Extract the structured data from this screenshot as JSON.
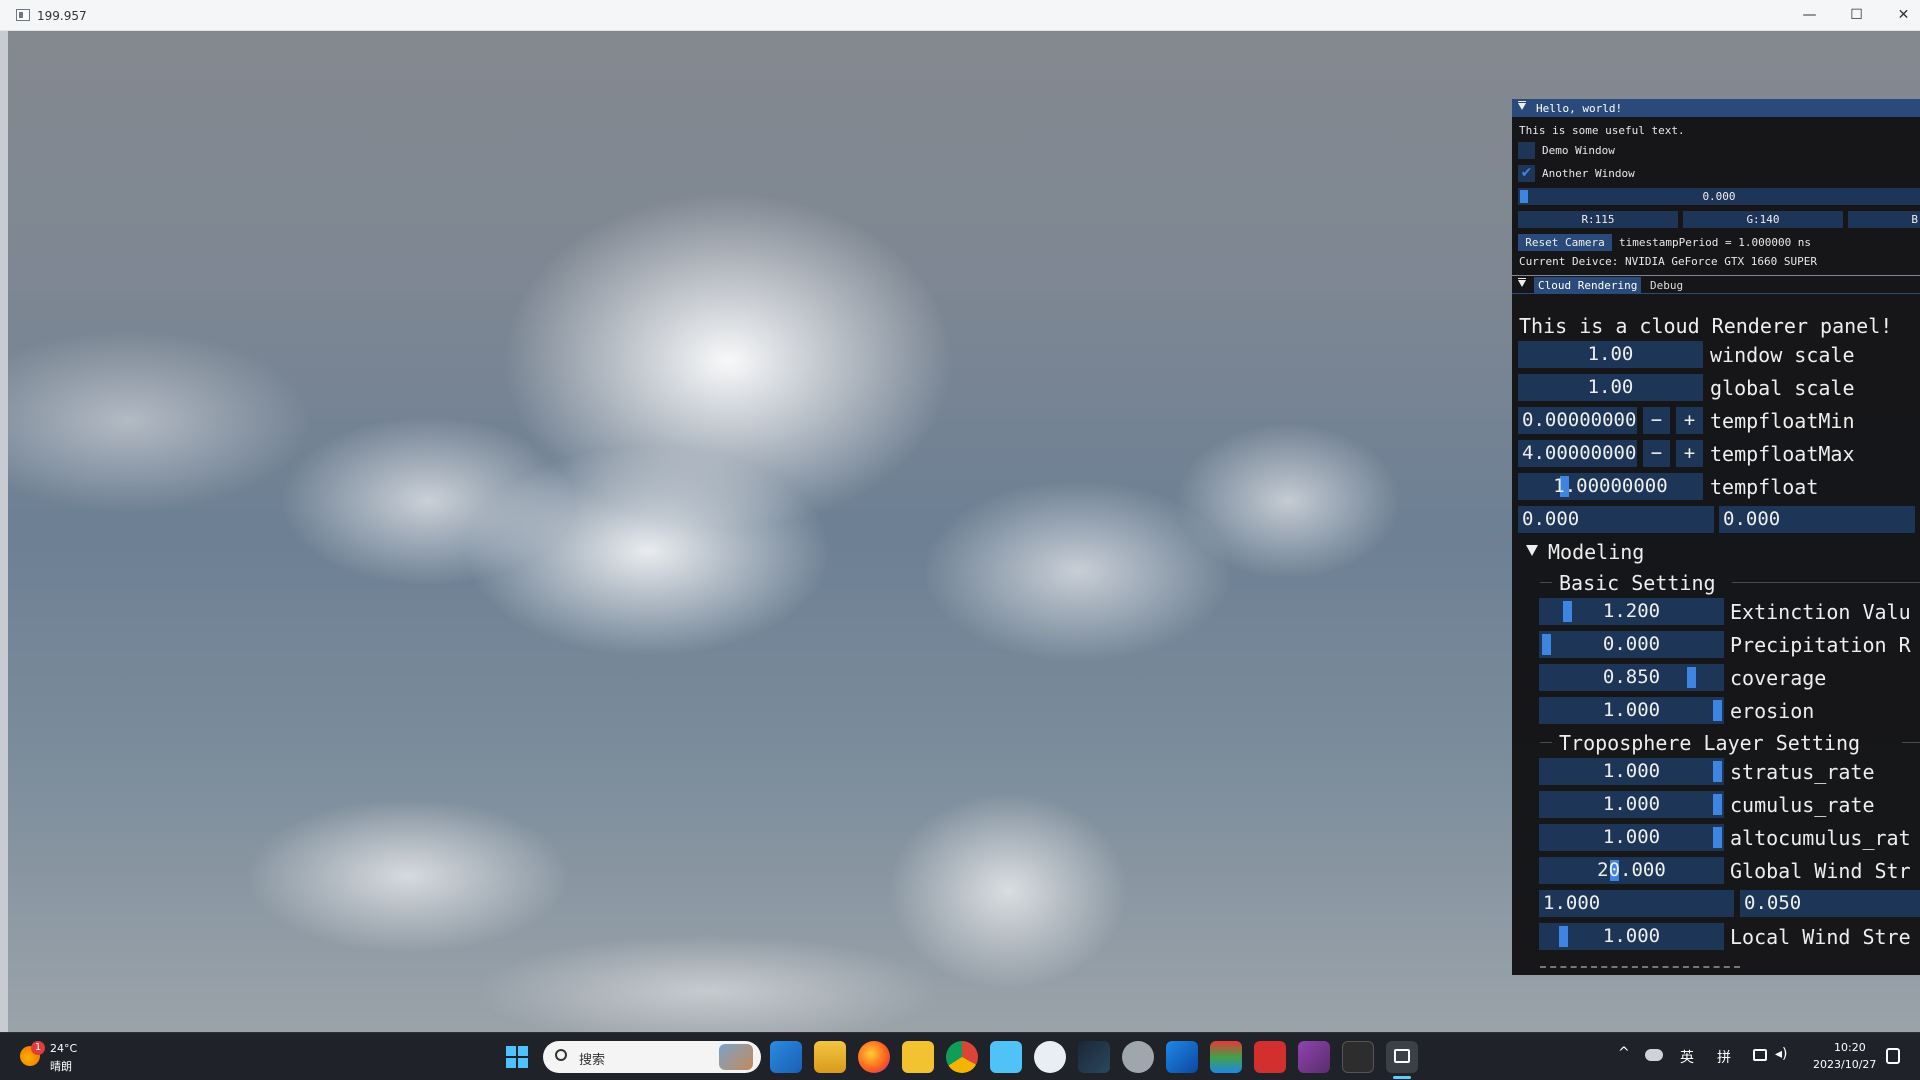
{
  "window": {
    "title": "199.957",
    "minimize": "—",
    "maximize": "☐",
    "close": "✕"
  },
  "hello": {
    "title": "Hello, world!",
    "useful_text": "This is some useful text.",
    "demo_window": "Demo Window",
    "another_window": "Another Window",
    "another_checked": true,
    "float_value": "0.000",
    "r": "R:115",
    "g": "G:140",
    "b": "B",
    "reset_camera": "Reset Camera",
    "timestamp": "timestampPeriod = 1.000000 ns",
    "device": "Current Deivce: NVIDIA GeForce GTX 1660 SUPER"
  },
  "cloud": {
    "tab_active": "Cloud Rendering",
    "tab_debug": "Debug",
    "panel_text": "This is a cloud Renderer panel!",
    "window_scale": {
      "value": "1.00",
      "label": "window scale"
    },
    "global_scale": {
      "value": "1.00",
      "label": "global scale"
    },
    "temp_min": {
      "value": "0.00000000",
      "label": "tempfloatMin"
    },
    "temp_max": {
      "value": "4.00000000",
      "label": "tempfloatMax"
    },
    "temp_float": {
      "value": "1.00000000",
      "label": "tempfloat"
    },
    "pair": [
      "0.000",
      "0.000"
    ],
    "minus": "−",
    "plus": "+",
    "modeling": "Modeling",
    "basic": "Basic Setting",
    "extinction": {
      "value": "1.200",
      "label": "Extinction Valu",
      "level": 0.12
    },
    "precipitation": {
      "value": "0.000",
      "label": "Precipitation R",
      "level": 0.0
    },
    "coverage": {
      "value": "0.850",
      "label": "coverage",
      "level": 0.85
    },
    "erosion": {
      "value": "1.000",
      "label": "erosion",
      "level": 1.0
    },
    "troposphere": "Troposphere Layer Setting",
    "stratus": {
      "value": "1.000",
      "label": "stratus_rate",
      "level": 1.0
    },
    "cumulus": {
      "value": "1.000",
      "label": "cumulus_rate",
      "level": 1.0
    },
    "altocumulus": {
      "value": "1.000",
      "label": "altocumulus_rat",
      "level": 1.0
    },
    "global_wind": {
      "value": "20.000",
      "label": "Global Wind Str",
      "level": 0.4
    },
    "wind_pair": [
      "1.000",
      "0.050"
    ],
    "local_wind": {
      "value": "1.000",
      "label": "Local Wind Stre",
      "level": 0.1
    }
  },
  "taskbar": {
    "temp": "24°C",
    "weather": "晴朗",
    "badge": "1",
    "search": "搜索",
    "ime1": "英",
    "ime2": "拼",
    "time": "10:20",
    "date": "2023/10/27"
  },
  "colors": {
    "accent": "#3d85e0",
    "frame": "#1d3557",
    "header": "#294a7a"
  }
}
